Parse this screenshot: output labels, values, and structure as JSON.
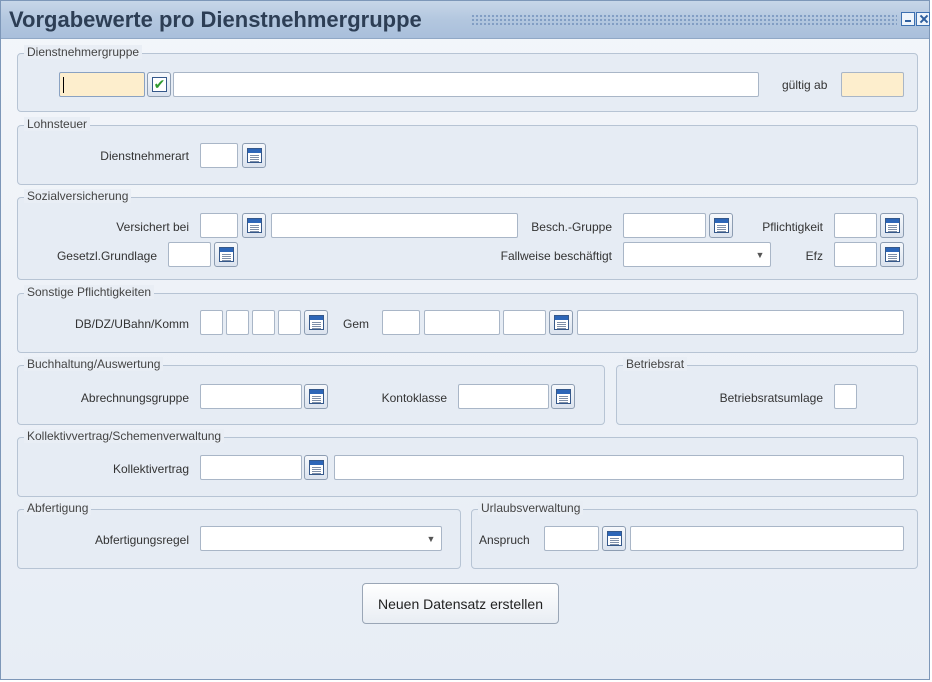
{
  "window": {
    "title": "Vorgabewerte pro Dienstnehmergruppe"
  },
  "sections": {
    "dienstnehmergruppe": {
      "legend": "Dienstnehmergruppe",
      "gueltig_ab_label": "gültig ab",
      "code_value": "",
      "name_value": "",
      "gueltig_ab_value": ""
    },
    "lohnsteuer": {
      "legend": "Lohnsteuer",
      "dienstnehmerart_label": "Dienstnehmerart",
      "dienstnehmerart_value": ""
    },
    "sozialversicherung": {
      "legend": "Sozialversicherung",
      "versichert_bei_label": "Versichert bei",
      "besch_gruppe_label": "Besch.-Gruppe",
      "pflichtigkeit_label": "Pflichtigkeit",
      "gesetzl_grundlage_label": "Gesetzl.Grundlage",
      "fallweise_label": "Fallweise beschäftigt",
      "efz_label": "Efz",
      "fallweise_value": ""
    },
    "sonstige": {
      "legend": "Sonstige Pflichtigkeiten",
      "db_label": "DB/DZ/UBahn/Komm",
      "gem_label": "Gem"
    },
    "buchhaltung": {
      "legend": "Buchhaltung/Auswertung",
      "abrechnungsgruppe_label": "Abrechnungsgruppe",
      "kontoklasse_label": "Kontoklasse"
    },
    "betriebsrat": {
      "legend": "Betriebsrat",
      "umlage_label": "Betriebsratsumlage"
    },
    "kollektivvertrag": {
      "legend": "Kollektivvertrag/Schemenverwaltung",
      "kollektivvertrag_label": "Kollektivertrag"
    },
    "abfertigung": {
      "legend": "Abfertigung",
      "regel_label": "Abfertigungsregel",
      "regel_value": ""
    },
    "urlaub": {
      "legend": "Urlaubsverwaltung",
      "anspruch_label": "Anspruch"
    }
  },
  "actions": {
    "create_label": "Neuen Datensatz erstellen"
  },
  "icons": {
    "lookup": "calendar-list-icon",
    "confirm": "checkmark-icon",
    "dropdown": "chevron-down-icon"
  },
  "colors": {
    "required_field": "#fdeecd",
    "titlebar": "#b3c7df",
    "title_text": "#2d3e55"
  }
}
